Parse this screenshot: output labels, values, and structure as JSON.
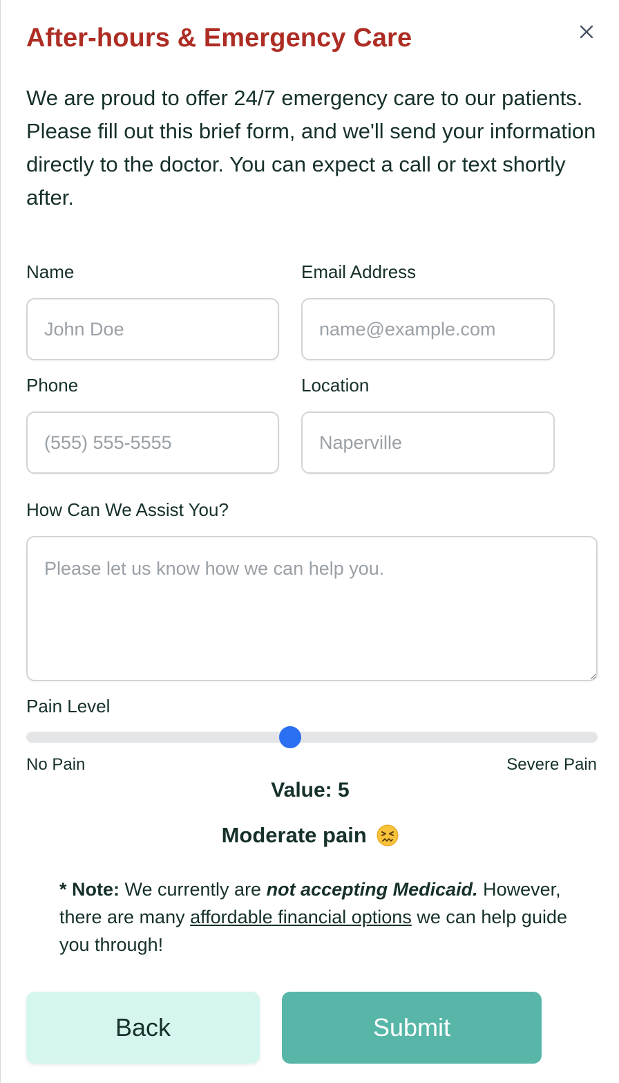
{
  "modal": {
    "title": "After-hours & Emergency Care",
    "intro": "We are proud to offer 24/7 emergency care to our patients. Please fill out this brief form, and we'll send your information directly to the doctor. You can expect a call or text shortly after.",
    "close_icon": "close-icon"
  },
  "form": {
    "name": {
      "label": "Name",
      "placeholder": "John Doe",
      "value": ""
    },
    "email": {
      "label": "Email Address",
      "placeholder": "name@example.com",
      "value": ""
    },
    "phone": {
      "label": "Phone",
      "placeholder": "(555) 555-5555",
      "value": ""
    },
    "location": {
      "label": "Location",
      "placeholder": "Naperville",
      "value": ""
    },
    "assist": {
      "label": "How Can We Assist You?",
      "placeholder": "Please let us know how we can help you.",
      "value": ""
    }
  },
  "pain": {
    "label": "Pain Level",
    "min_label": "No Pain",
    "max_label": "Severe Pain",
    "min": 0,
    "max": 10,
    "value": 5,
    "value_text": "Value: 5",
    "description": "Moderate pain",
    "emoji_icon": "confounded-face-icon"
  },
  "note": {
    "prefix": "* Note:",
    "text1": " We currently are ",
    "emphasis": "not accepting Medicaid.",
    "text2": " However, there are many ",
    "link": "affordable financial options",
    "text3": " we can help guide you through!"
  },
  "actions": {
    "back_label": "Back",
    "submit_label": "Submit"
  },
  "colors": {
    "title": "#ad2d24",
    "text": "#16302b",
    "slider_thumb": "#2b6ff2",
    "back_bg": "#d5f6ef",
    "submit_bg": "#57b6a7"
  }
}
